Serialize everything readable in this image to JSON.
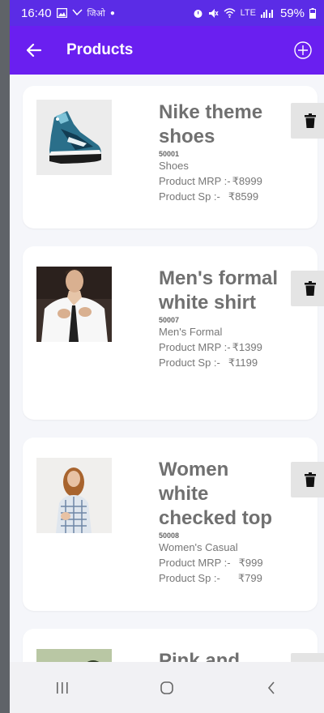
{
  "status": {
    "time": "16:40",
    "carrier": "जिओ",
    "battery": "59%",
    "network_label": "LTE"
  },
  "appbar": {
    "title": "Products"
  },
  "products": [
    {
      "name": "Nike theme shoes",
      "code": "50001",
      "category": "Shoes",
      "mrp_label": "Product MRP :-",
      "mrp": "₹8999",
      "sp_label": "Product Sp :-",
      "sp": "₹8599",
      "image": "sneaker"
    },
    {
      "name": "Men's formal white shirt",
      "code": "50007",
      "category": "Men's Formal",
      "mrp_label": "Product MRP :-",
      "mrp": "₹1399",
      "sp_label": "Product Sp :-",
      "sp": "₹1199",
      "image": "man-in-white-shirt"
    },
    {
      "name": "Women white checked top",
      "code": "50008",
      "category": "Women's Casual",
      "mrp_label": "Product MRP :-",
      "mrp": "₹999",
      "sp_label": "Product Sp :-",
      "sp": "₹799",
      "image": "woman-in-checked-top"
    },
    {
      "name": "Pink and",
      "image": "people-outdoors"
    }
  ],
  "navbar": {
    "items": [
      "recents-icon",
      "home-icon",
      "back-icon"
    ]
  },
  "colors": {
    "primary": "#6a1ff0",
    "status": "#5b2ce6",
    "card": "#ffffff",
    "background": "#f5f6fa",
    "delete_bg": "#e4e4e4"
  }
}
